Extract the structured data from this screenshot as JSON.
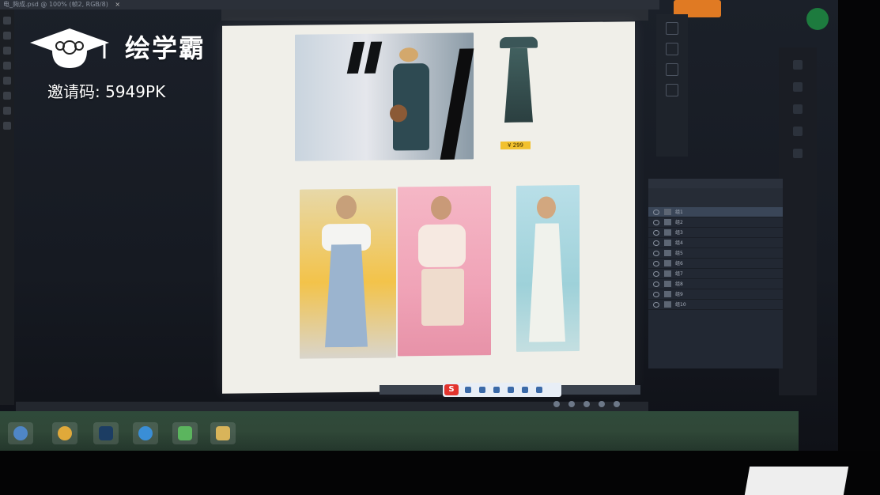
{
  "watermark": {
    "brand": "绘学霸",
    "invite_label": "邀请码: ",
    "invite_code": "5949PK"
  },
  "window": {
    "tab_title": "电_夠成.psd @ 100% (帧2, RGB/8)",
    "tab_close": "×"
  },
  "canvas": {
    "price_tag": "¥ 299"
  },
  "ime": {
    "label": "S"
  },
  "layers": [
    {
      "label": "组1"
    },
    {
      "label": "组2"
    },
    {
      "label": "组3"
    },
    {
      "label": "组4"
    },
    {
      "label": "组5"
    },
    {
      "label": "组6"
    },
    {
      "label": "组7"
    },
    {
      "label": "组8"
    },
    {
      "label": "组9"
    },
    {
      "label": "组10"
    }
  ],
  "colors": {
    "price_tag": "#f2c12e",
    "ime_brand": "#e3342e",
    "taskbar": "#2f4a3a"
  }
}
